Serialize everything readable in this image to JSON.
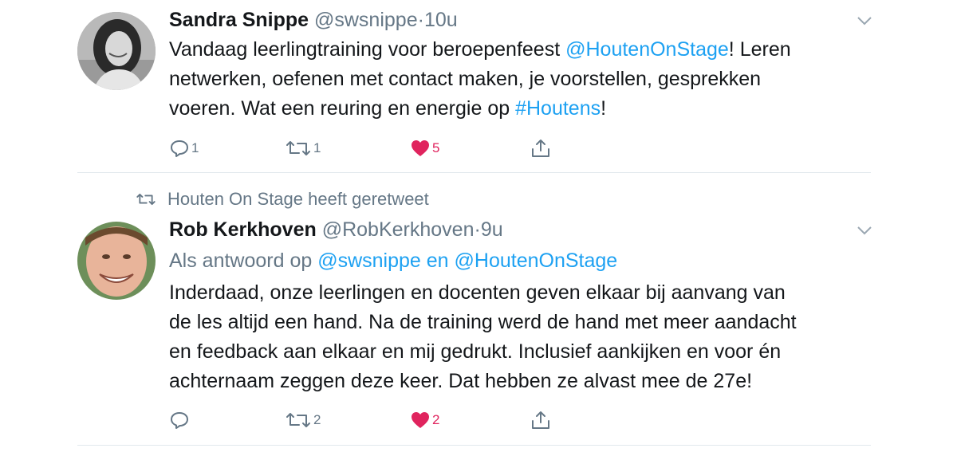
{
  "tweets": [
    {
      "author_name": "Sandra Snippe",
      "author_handle": "@swsnippe",
      "separator": "·",
      "time": "10u",
      "text_parts": [
        {
          "text": "Vandaag leerlingtraining voor beroepenfeest ",
          "link": false
        },
        {
          "text": "@HoutenOnStage",
          "link": true
        },
        {
          "text": "! Leren\nnetwerken,  oefenen met contact maken, je voorstellen,  gesprekken\nvoeren. Wat een reuring en energie op ",
          "link": false
        },
        {
          "text": "#Houtens",
          "link": true
        },
        {
          "text": "!",
          "link": false
        }
      ],
      "reply_count": "1",
      "retweet_count": "1",
      "like_count": "5",
      "liked": true,
      "avatar_icon": "avatar-photo-woman"
    },
    {
      "retweet_context": "Houten On Stage heeft geretweet",
      "author_name": "Rob Kerkhoven",
      "author_handle": "@RobKerkhoven",
      "separator": "·",
      "time": "9u",
      "reply_prefix": "Als antwoord op ",
      "reply_user_1": "@swsnippe",
      "reply_and": " en ",
      "reply_user_2": "@HoutenOnStage",
      "text": "Inderdaad, onze leerlingen en docenten geven elkaar bij aanvang van\nde les altijd een hand. Na de training werd de hand met meer aandacht\nen feedback aan elkaar en mij gedrukt. Inclusief aankijken en voor én\nachternaam zeggen deze keer. Dat hebben ze alvast mee de 27e!",
      "reply_count": "",
      "retweet_count": "2",
      "like_count": "2",
      "liked": true,
      "avatar_icon": "avatar-photo-man"
    }
  ],
  "colors": {
    "link": "#1da1f2",
    "secondary_text": "#657786",
    "like": "#e0245e",
    "divider": "#e1e8ed"
  },
  "icons": [
    "reply-icon",
    "retweet-icon",
    "heart-icon",
    "share-icon",
    "chevron-down-icon"
  ]
}
